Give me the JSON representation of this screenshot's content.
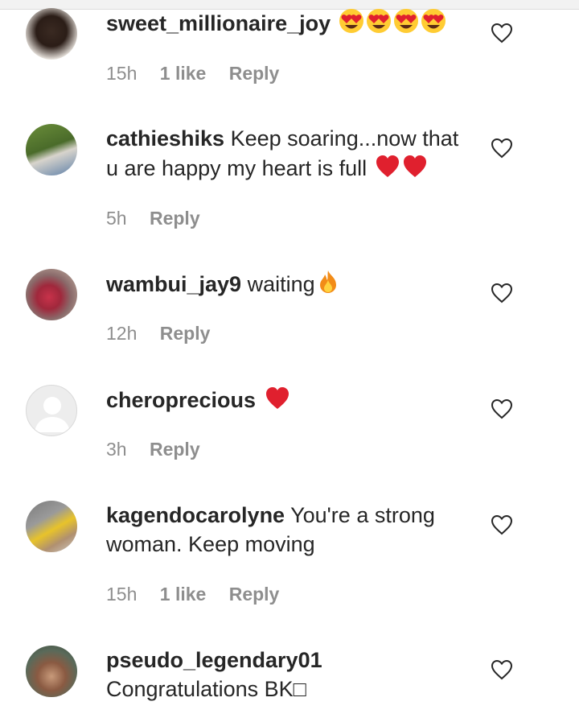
{
  "comments": [
    {
      "username": "sweet_millionaire_joy",
      "text": "",
      "emojis": "heart-eyes-emoji x4",
      "time": "15h",
      "likes": "1 like",
      "reply": "Reply"
    },
    {
      "username": "cathieshiks",
      "text": "Keep soaring...now that u are happy my heart is full",
      "emojis": "red-heart-emoji x2",
      "time": "5h",
      "reply": "Reply"
    },
    {
      "username": "wambui_jay9",
      "text": "waiting",
      "emojis": "fire-emoji",
      "time": "12h",
      "reply": "Reply"
    },
    {
      "username": "cheroprecious",
      "text": "",
      "emojis": "red-heart-emoji",
      "time": "3h",
      "reply": "Reply"
    },
    {
      "username": "kagendocarolyne",
      "text": "You're a strong woman. Keep moving",
      "time": "15h",
      "likes": "1 like",
      "reply": "Reply"
    },
    {
      "username": "pseudo_legendary01",
      "text": "Congratulations BK□"
    }
  ],
  "colors": {
    "text": "#262626",
    "meta": "#8e8e8e",
    "heart_red": "#e0202e",
    "background": "#ffffff"
  }
}
